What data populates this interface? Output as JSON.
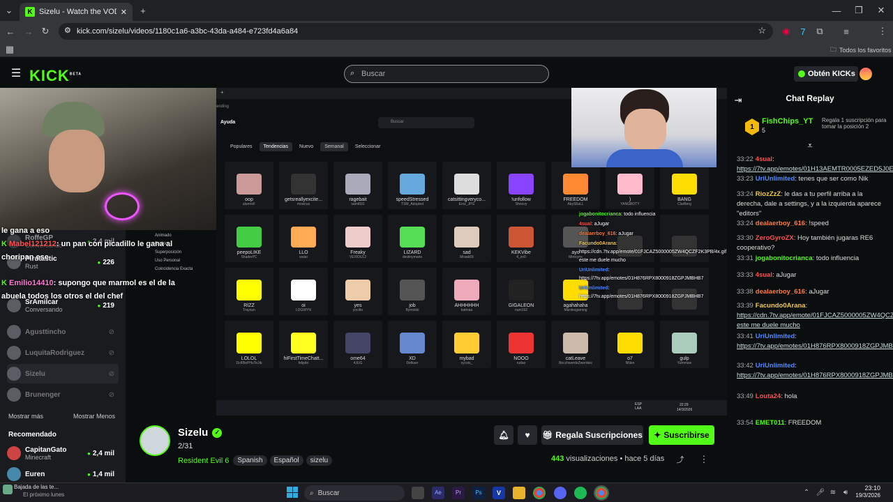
{
  "browser": {
    "tab_title": "Sizelu - Watch the VOD on Ki",
    "url": "kick.com/sizelu/videos/1180c1a6-a3bc-43da-a484-e723fd4a6a84",
    "bookmarks_label": "Todos los favoritos"
  },
  "header": {
    "logo": "KICK",
    "logo_beta": "BETA",
    "search_placeholder": "Buscar",
    "obten_label": "Obtén KICKs"
  },
  "sidebar": {
    "items": [
      {
        "name": "RoffeGP",
        "sub": "Conversando",
        "count": "2,4 mil"
      },
      {
        "name": "Pirutastic",
        "sub": "Rust",
        "count": "226"
      },
      {
        "name": "SrAmilcar",
        "sub": "Conversando",
        "count": "219"
      },
      {
        "name": "Agusttincho",
        "sub": "",
        "count": ""
      },
      {
        "name": "LuquitaRodriguez",
        "sub": "",
        "count": ""
      },
      {
        "name": "Sizelu",
        "sub": "",
        "count": ""
      },
      {
        "name": "Brunenger",
        "sub": "",
        "count": ""
      }
    ],
    "show_more": "Mostrar más",
    "show_less": "Mostrar Menos",
    "recommended_title": "Recomendado",
    "recommended": [
      {
        "name": "CapitanGato",
        "sub": "Minecraft",
        "count": "2,4 mil"
      },
      {
        "name": "Euren",
        "sub": "",
        "count": "1,4 mil"
      }
    ]
  },
  "overlay_chat": [
    {
      "user": "",
      "text": "le gana a eso"
    },
    {
      "user": "Mabel121212",
      "text": ": un pan con picadillo le gana al choripan ese"
    },
    {
      "user": "Emilio14410",
      "text": ": supongo que marmol es el de la abuela todos los otros el del chef"
    }
  ],
  "inner_ui": {
    "tab_label": "ending",
    "help": "Ayuda",
    "search": "Buscar",
    "tabs": [
      "Populares",
      "Tendencias",
      "Nuevo",
      "Semanal",
      "Seleccionar"
    ],
    "sidebar_labels": [
      "Animado",
      "Estático",
      "Superposición",
      "Uso Personal",
      "Coincidencia Exacta"
    ],
    "emotes": [
      {
        "name": "oop",
        "by": "alumroF"
      },
      {
        "name": "getsreallyexcite...",
        "by": "mowcus"
      },
      {
        "name": "ragebait",
        "by": "samt691"
      },
      {
        "name": "speedStressed",
        "by": "TSM_Adopted"
      },
      {
        "name": "catsittingverycо...",
        "by": "Eroz_JPG"
      },
      {
        "name": "!unfollow",
        "by": "Shoovy"
      },
      {
        "name": "FREEDOM",
        "by": "AbyS5aLL"
      },
      {
        "name": ")",
        "by": "YANGBOTY"
      },
      {
        "name": "BANG",
        "by": "ClarBerg"
      },
      {
        "name": "peepoLIKE",
        "by": "ShaderPC"
      },
      {
        "name": "LLO",
        "by": "waiai"
      },
      {
        "name": "Freaky",
        "by": "VEXIDUL2"
      },
      {
        "name": "LIZARD",
        "by": "destinymarie"
      },
      {
        "name": "sad",
        "by": "Mraak69"
      },
      {
        "name": "KEKVibe",
        "by": "4_zn0"
      },
      {
        "name": "ayo",
        "by": "Minicyns"
      },
      {
        "name": "",
        "by": ""
      },
      {
        "name": "",
        "by": ""
      },
      {
        "name": "RIZZ",
        "by": "Traysun"
      },
      {
        "name": "oi",
        "by": "LDGWYN"
      },
      {
        "name": "yes",
        "by": "yocitto"
      },
      {
        "name": "job",
        "by": "Bymokki"
      },
      {
        "name": "AHHHHHH",
        "by": "katmaa"
      },
      {
        "name": "GIGALEON",
        "by": "num162"
      },
      {
        "name": "agahahaha",
        "by": "Mardexgaming"
      },
      {
        "name": "",
        "by": ""
      },
      {
        "name": "",
        "by": ""
      },
      {
        "name": "LOLOL",
        "by": "DcKBePHuTeJib"
      },
      {
        "name": "hiFirstTimeChatt...",
        "by": "felipito"
      },
      {
        "name": "ome64",
        "by": "4JUG"
      },
      {
        "name": "XD",
        "by": "Delkser"
      },
      {
        "name": "mybad",
        "by": "sycsts_"
      },
      {
        "name": "NOOO",
        "by": "rudao"
      },
      {
        "name": "catLeave",
        "by": "BocchwerdeZwerdeis"
      },
      {
        "name": "o7",
        "by": "NNeo"
      },
      {
        "name": "gulp",
        "by": "Yummsie"
      }
    ]
  },
  "inner_chat": [
    {
      "user": "jogabonitocrianca",
      "text": ": todo influencia"
    },
    {
      "user": "4sual",
      "text": ": aJugar"
    },
    {
      "user": "dealaerboy_616",
      "text": ": aJugar"
    },
    {
      "user": "Facundo0Arana",
      "text": ": https://cdn.7tv.app/emote/01FJCAZ5000005ZW4QCZF2K3PB/4x.gif este me duele mucho"
    },
    {
      "user": "UriUnlimited",
      "text": ": https://7tv.app/emotes/01H876RPX8000918ZGPJMBHB7"
    },
    {
      "user": "UriUnlimited",
      "text": ": https://7tv.app/emotes/01H876RPX8000918ZGPJMBHB7"
    }
  ],
  "inner_taskbar": {
    "lang": "ESP LAA",
    "time": "22:29",
    "date": "14/3/2026"
  },
  "stream": {
    "name": "Sizelu",
    "vod_index": "2/31",
    "game": "Resident Evil 6",
    "tags": [
      "Spanish",
      "Español",
      "sizelu"
    ],
    "gift_label": "Regala Suscripciones",
    "subscribe_label": "Suscribirse",
    "views": "443",
    "views_label": "visualizaciones",
    "ago": "hace 5 días"
  },
  "chat": {
    "title": "Chat Replay",
    "pinned_user": "FishChips_YT",
    "pinned_count": "5",
    "gift_text": "Regala 1 suscripción para tomar la posición 2",
    "messages": [
      {
        "time": "33:22",
        "user": "4sual",
        "color": "#ff4f4f",
        "text": "https://7tv.app/emotes/01H13AEMTR0005EZED5J0EXN3C",
        "link": true
      },
      {
        "time": "33:23",
        "user": "UriUnlimited",
        "color": "#4f8bff",
        "text": "tenes que ser como Nik",
        "link": false
      },
      {
        "time": "33:24",
        "user": "RiozZzZ",
        "color": "#f2c94c",
        "text": "le das a tu perfil arriba a la derecha, dale a settings, y a la izquierda aparece \"editors\"",
        "link": false
      },
      {
        "time": "33:24",
        "user": "dealaerboy_616",
        "color": "#ff7a3d",
        "text": "!speed",
        "link": false
      },
      {
        "time": "33:30",
        "user": "ZeroGyroZX",
        "color": "#ff4f4f",
        "text": "Hoy también jugaras RE6 cooperativo?",
        "link": false
      },
      {
        "time": "33:31",
        "user": "jogabonitocrianca",
        "color": "#53fc18",
        "text": "todo influencia",
        "link": false
      },
      {
        "time": "33:33",
        "user": "4sual",
        "color": "#ff4f4f",
        "text": "aJugar",
        "link": false
      },
      {
        "time": "33:38",
        "user": "dealaerboy_616",
        "color": "#ff7a3d",
        "text": "aJugar",
        "link": false
      },
      {
        "time": "33:39",
        "user": "Facundo0Arana",
        "color": "#f2c94c",
        "text": "https://cdn.7tv.app/emote/01FJCAZ5000005ZW4QCZF2K3PB/4x.gif este me duele mucho",
        "link": true
      },
      {
        "time": "33:41",
        "user": "UriUnlimited",
        "color": "#4f8bff",
        "text": "https://7tv.app/emotes/01H876RPX8000918ZGPJMBHB7Z",
        "link": true
      },
      {
        "time": "33:42",
        "user": "UriUnlimited",
        "color": "#4f8bff",
        "text": "https://7tv.app/emotes/01H876RPX8000918ZGPJMBHB7Z",
        "link": true
      },
      {
        "time": "33:49",
        "user": "Louta24",
        "color": "#ff4f4f",
        "text": "hola",
        "link": false
      },
      {
        "time": "33:54",
        "user": "EMET011",
        "color": "#53fc18",
        "text": "FREEDOM",
        "link": false
      }
    ]
  },
  "taskbar": {
    "weather_title": "Bajada de las te...",
    "weather_sub": "El próximo lunes",
    "search": "Buscar",
    "time": "23:10",
    "date": "19/3/2026"
  },
  "colors": {
    "accent": "#53fc18",
    "bg": "#0b0e0f",
    "sidebar": "#191b1f"
  }
}
